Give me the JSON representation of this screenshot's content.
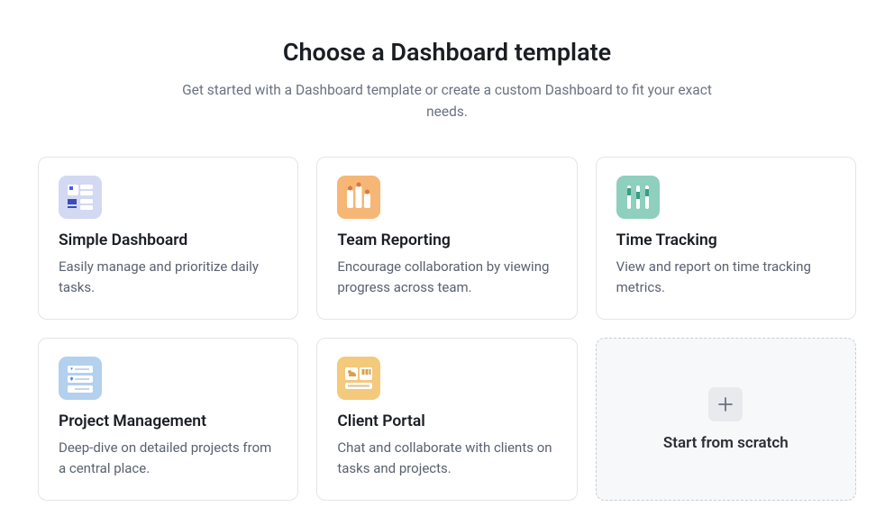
{
  "header": {
    "title": "Choose a Dashboard template",
    "subtitle": "Get started with a Dashboard template or create a custom Dashboard to fit your exact needs."
  },
  "templates": [
    {
      "name": "Simple Dashboard",
      "desc": "Easily manage and prioritize daily tasks.",
      "icon": "simple-dashboard-icon",
      "bg": "#d3d9f2"
    },
    {
      "name": "Team Reporting",
      "desc": "Encourage collaboration by viewing progress across team.",
      "icon": "team-reporting-icon",
      "bg": "#f6b776"
    },
    {
      "name": "Time Tracking",
      "desc": "View and report on time tracking metrics.",
      "icon": "time-tracking-icon",
      "bg": "#8ecfbd"
    },
    {
      "name": "Project Management",
      "desc": "Deep-dive on detailed projects from a central place.",
      "icon": "project-management-icon",
      "bg": "#b3d0ee"
    },
    {
      "name": "Client Portal",
      "desc": "Chat and collaborate with clients on tasks and projects.",
      "icon": "client-portal-icon",
      "bg": "#f3c97c"
    }
  ],
  "scratch": {
    "label": "Start from scratch"
  }
}
